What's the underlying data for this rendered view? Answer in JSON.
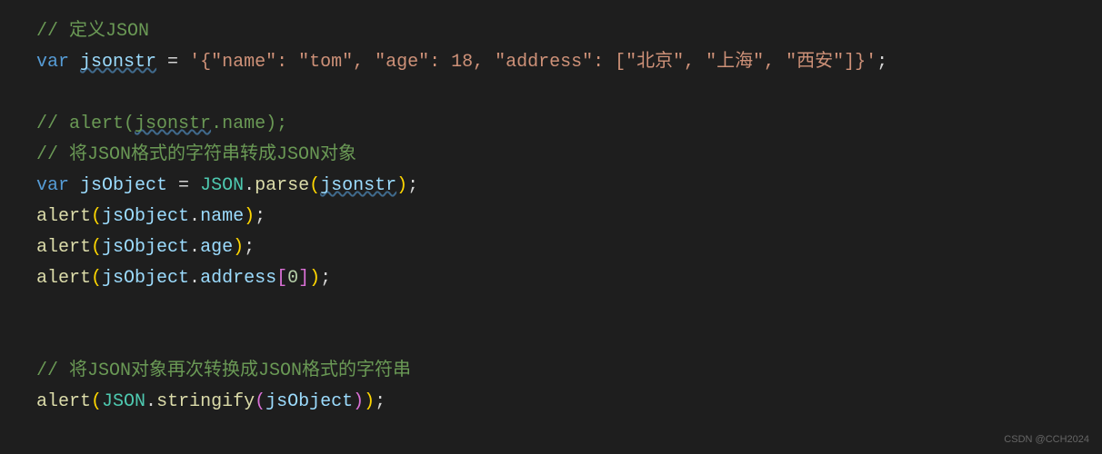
{
  "lines": {
    "comment1": "// 定义JSON",
    "var1": "var",
    "jsonstr": "jsonstr",
    "equals": " = ",
    "jsonstr_value": "'{\"name\": \"tom\", \"age\": 18, \"address\": [\"北京\", \"上海\", \"西安\"]}'",
    "semicolon": ";",
    "comment2_prefix": "// ",
    "comment2_alert": "alert",
    "comment2_open": "(",
    "comment2_jsonstr": "jsonstr",
    "comment2_rest": ".name);",
    "comment3": "// 将JSON格式的字符串转成JSON对象",
    "var2": "var",
    "jsObject": "jsObject",
    "json_obj": "JSON",
    "dot": ".",
    "parse": "parse",
    "name_prop": "name",
    "age_prop": "age",
    "address_prop": "address",
    "zero": "0",
    "alert": "alert",
    "stringify": "stringify",
    "comment4": "// 将JSON对象再次转换成JSON格式的字符串",
    "open_paren": "(",
    "close_paren": ")",
    "open_bracket": "[",
    "close_bracket": "]"
  },
  "watermark": "CSDN @CCH2024"
}
